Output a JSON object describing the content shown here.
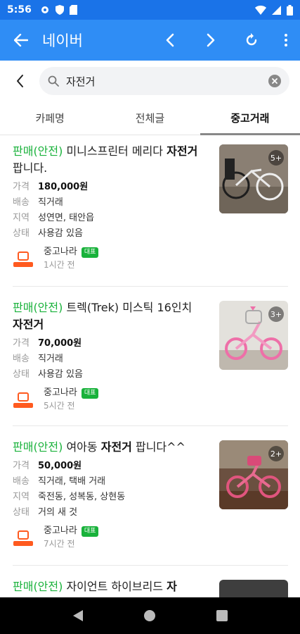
{
  "status_bar": {
    "time": "5:56"
  },
  "app_bar": {
    "title": "네이버"
  },
  "search": {
    "query": "자전거"
  },
  "tabs": [
    {
      "label": "카페명"
    },
    {
      "label": "전체글"
    },
    {
      "label": "중고거래"
    }
  ],
  "labels": {
    "price": "가격",
    "delivery": "배송",
    "region": "지역",
    "condition": "상태"
  },
  "listings": [
    {
      "tag": "판매(안전)",
      "title_pre": " 미니스프린터 메리다 ",
      "title_keyword": "자전거",
      "title_post": " 팝니다.",
      "price": "180,000원",
      "delivery": "직거래",
      "region": "성연면, 태안읍",
      "condition": "사용감 있음",
      "cafe_name": "중고나라",
      "cafe_badge": "대표",
      "time": "1시간 전",
      "photo_count": "5+"
    },
    {
      "tag": "판매(안전)",
      "title_pre": " 트렉(Trek) 미스틱 16인치 ",
      "title_keyword": "자전거",
      "title_post": "",
      "price": "70,000원",
      "delivery": "직거래",
      "condition": "사용감 있음",
      "cafe_name": "중고나라",
      "cafe_badge": "대표",
      "time": "5시간 전",
      "photo_count": "3+"
    },
    {
      "tag": "판매(안전)",
      "title_pre": " 여아동 ",
      "title_keyword": "자전거",
      "title_post": " 팝니다^^",
      "price": "50,000원",
      "delivery": "직거래, 택배 거래",
      "region": "죽전동, 성복동, 상현동",
      "condition": "거의 새 것",
      "cafe_name": "중고나라",
      "cafe_badge": "대표",
      "time": "7시간 전",
      "photo_count": "2+"
    },
    {
      "tag": "판매(안전)",
      "title_pre": " 자이언트 하이브리드 ",
      "title_keyword": "자"
    }
  ],
  "colors": {
    "status_bar": "#1a73e8",
    "app_bar": "#2f8df5",
    "safe_tag": "#19b23b",
    "cafe_logo": "#ff5a1f"
  },
  "icons": [
    "back-arrow-icon",
    "chevron-left-icon",
    "chevron-right-icon",
    "refresh-icon",
    "more-vert-icon",
    "search-icon",
    "clear-icon"
  ]
}
